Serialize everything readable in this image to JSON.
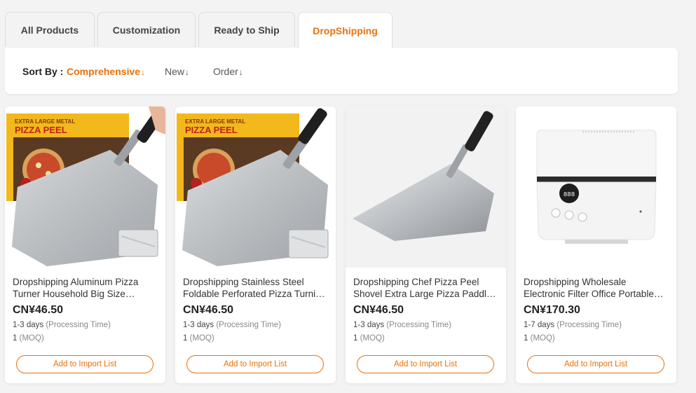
{
  "tabs": [
    {
      "label": "All Products",
      "active": false
    },
    {
      "label": "Customization",
      "active": false
    },
    {
      "label": "Ready to Ship",
      "active": false
    },
    {
      "label": "DropShipping",
      "active": true
    }
  ],
  "sort": {
    "label": "Sort By :",
    "options": [
      {
        "label": "Comprehensive",
        "arrow": "↓",
        "active": true
      },
      {
        "label": "New",
        "arrow": "↓",
        "active": false
      },
      {
        "label": "Order",
        "arrow": "↓",
        "active": false
      }
    ]
  },
  "products": [
    {
      "title": "Dropshipping Aluminum Pizza Turner Household Big Size Foldable Pizza Peel",
      "price": "CN¥46.50",
      "processing_days": "1-3 days",
      "processing_label": "(Processing Time)",
      "moq_value": "1",
      "moq_label": "(MOQ)",
      "button": "Add to Import List",
      "box_line1": "EXTRA LARGE METAL",
      "box_line2": "PIZZA PEEL"
    },
    {
      "title": "Dropshipping Stainless Steel Foldable Perforated Pizza Turning Peel",
      "price": "CN¥46.50",
      "processing_days": "1-3 days",
      "processing_label": "(Processing Time)",
      "moq_value": "1",
      "moq_label": "(MOQ)",
      "button": "Add to Import List",
      "box_line1": "EXTRA LARGE METAL",
      "box_line2": "PIZZA PEEL"
    },
    {
      "title": "Dropshipping Chef Pizza Peel Shovel Extra Large Pizza Paddle Set",
      "price": "CN¥46.50",
      "processing_days": "1-3 days",
      "processing_label": "(Processing Time)",
      "moq_value": "1",
      "moq_label": "(MOQ)",
      "button": "Add to Import List"
    },
    {
      "title": "Dropshipping Wholesale Electronic Filter Office Portable Air Purifier",
      "price": "CN¥170.30",
      "processing_days": "1-7 days",
      "processing_label": "(Processing Time)",
      "moq_value": "1",
      "moq_label": "(MOQ)",
      "button": "Add to Import List",
      "display_digits": "888"
    }
  ],
  "colors": {
    "accent": "#e8710a",
    "background": "#f3f3f3",
    "card": "#ffffff"
  }
}
